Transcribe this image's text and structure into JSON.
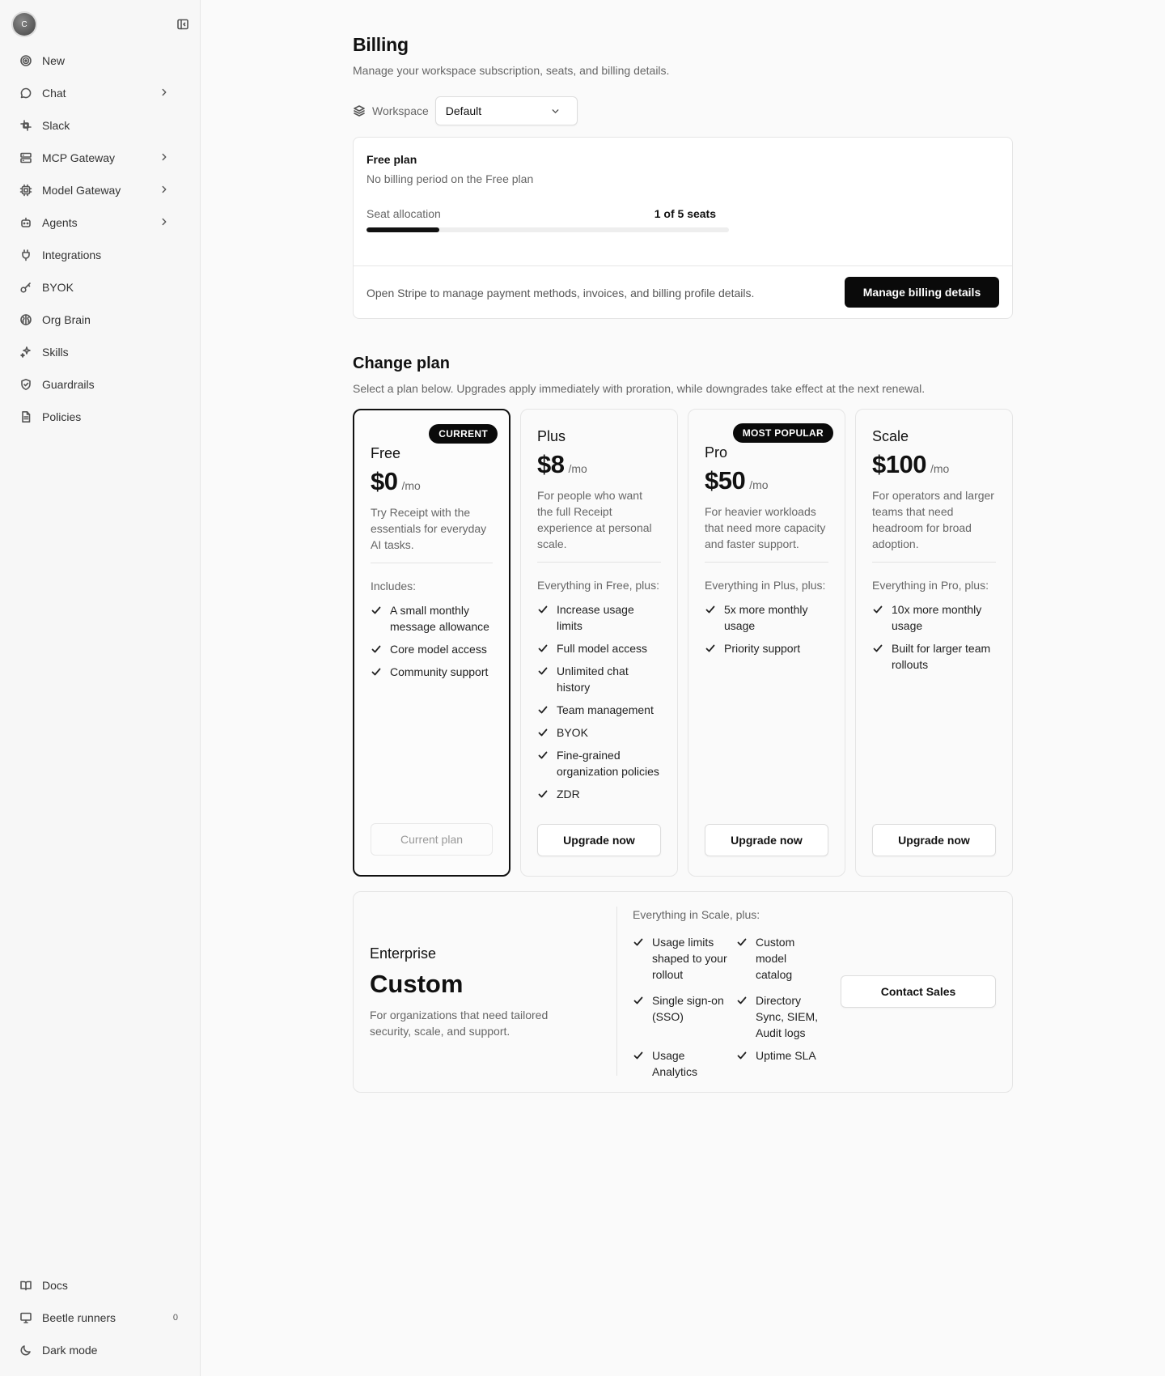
{
  "sidebar": {
    "avatar_initial": "C",
    "items": [
      {
        "label": "New",
        "icon": "target-icon",
        "chevron": false
      },
      {
        "label": "Chat",
        "icon": "chat-bubble-icon",
        "chevron": true
      },
      {
        "label": "Slack",
        "icon": "slack-icon",
        "chevron": false
      },
      {
        "label": "MCP Gateway",
        "icon": "server-icon",
        "chevron": true
      },
      {
        "label": "Model Gateway",
        "icon": "cpu-icon",
        "chevron": true
      },
      {
        "label": "Agents",
        "icon": "robot-icon",
        "chevron": true
      },
      {
        "label": "Integrations",
        "icon": "plug-icon",
        "chevron": false
      },
      {
        "label": "BYOK",
        "icon": "key-icon",
        "chevron": false
      },
      {
        "label": "Org Brain",
        "icon": "brain-icon",
        "chevron": false
      },
      {
        "label": "Skills",
        "icon": "sparkle-icon",
        "chevron": false
      },
      {
        "label": "Guardrails",
        "icon": "shield-icon",
        "chevron": false
      },
      {
        "label": "Policies",
        "icon": "document-icon",
        "chevron": false
      }
    ],
    "bottom": {
      "docs": "Docs",
      "runners": "Beetle runners",
      "runners_count": "0",
      "dark_mode": "Dark mode"
    }
  },
  "header": {
    "title": "Billing",
    "subtitle": "Manage your workspace subscription, seats, and billing details."
  },
  "workspace": {
    "label": "Workspace",
    "selected": "Default"
  },
  "current_plan": {
    "title": "Free plan",
    "subtitle": "No billing period on the Free plan",
    "seat_label": "Seat allocation",
    "seat_count": "1 of 5 seats",
    "seat_fraction": 0.2,
    "stripe_text": "Open Stripe to manage payment methods, invoices, and billing profile details.",
    "manage_button": "Manage billing details"
  },
  "change_plan": {
    "title": "Change plan",
    "subtitle": "Select a plan below. Upgrades apply immediately with proration, while downgrades take effect at the next renewal."
  },
  "tiers": [
    {
      "badge": "CURRENT",
      "name": "Free",
      "price": "$0",
      "per": "/mo",
      "desc": "Try Receipt with the essentials for everyday AI tasks.",
      "includes": "Includes:",
      "features": [
        "A small monthly message allowance",
        "Core model access",
        "Community support"
      ],
      "button": "Current plan"
    },
    {
      "badge": "",
      "name": "Plus",
      "price": "$8",
      "per": "/mo",
      "desc": "For people who want the full Receipt experience at personal scale.",
      "includes": "Everything in Free, plus:",
      "features": [
        "Increase usage limits",
        "Full model access",
        "Unlimited chat history",
        "Team management",
        "BYOK",
        "Fine-grained organization policies",
        "ZDR"
      ],
      "button": "Upgrade now"
    },
    {
      "badge": "MOST POPULAR",
      "name": "Pro",
      "price": "$50",
      "per": "/mo",
      "desc": "For heavier workloads that need more capacity and faster support.",
      "includes": "Everything in Plus, plus:",
      "features": [
        "5x more monthly usage",
        "Priority support"
      ],
      "button": "Upgrade now"
    },
    {
      "badge": "",
      "name": "Scale",
      "price": "$100",
      "per": "/mo",
      "desc": "For operators and larger teams that need headroom for broad adoption.",
      "includes": "Everything in Pro, plus:",
      "features": [
        "10x more monthly usage",
        "Built for larger team rollouts"
      ],
      "button": "Upgrade now"
    }
  ],
  "enterprise": {
    "name": "Enterprise",
    "price": "Custom",
    "desc": "For organizations that need tailored security, scale, and support.",
    "includes": "Everything in Scale, plus:",
    "features_col1": [
      "Usage limits shaped to your rollout",
      "Single sign-on (SSO)",
      "Usage Analytics"
    ],
    "features_col2": [
      "Custom model catalog",
      "Directory Sync, SIEM, Audit logs",
      "Uptime SLA"
    ],
    "button": "Contact Sales"
  }
}
